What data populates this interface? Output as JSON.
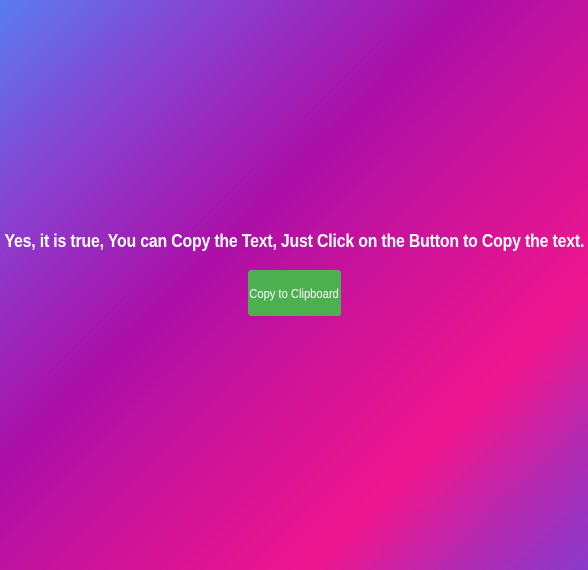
{
  "main": {
    "message": "Yes, it is true, You can Copy the Text, Just Click on the Button to Copy the text.",
    "copy_button_label": "Copy to Clipboard"
  },
  "colors": {
    "background_gradient": [
      "#5a7cf0",
      "#ab10a8",
      "#ee168e",
      "#8a3acb"
    ],
    "button": "#4caf50",
    "text": "#ffffff"
  }
}
